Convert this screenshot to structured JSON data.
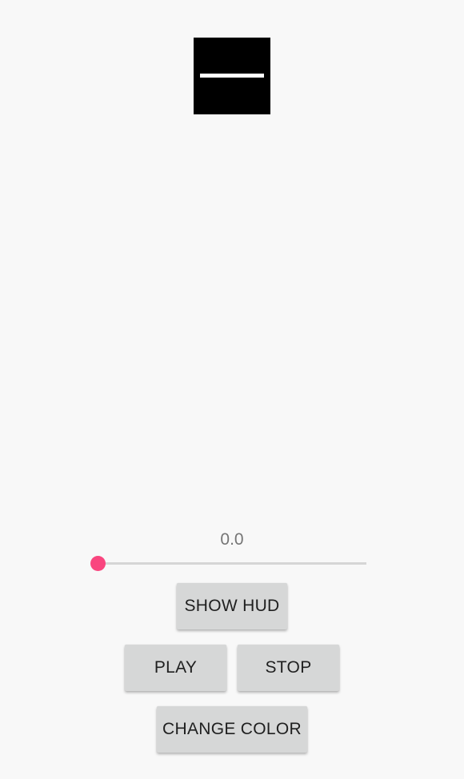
{
  "preview": {
    "icon": "horizontal-line-icon",
    "background_color": "#000000",
    "line_color": "#ffffff"
  },
  "progress": {
    "value_label": "0.0",
    "value": 0.0,
    "accent_color": "#ff4081"
  },
  "buttons": {
    "show_hud": "SHOW HUD",
    "play": "PLAY",
    "stop": "STOP",
    "change_color": "CHANGE COLOR"
  }
}
